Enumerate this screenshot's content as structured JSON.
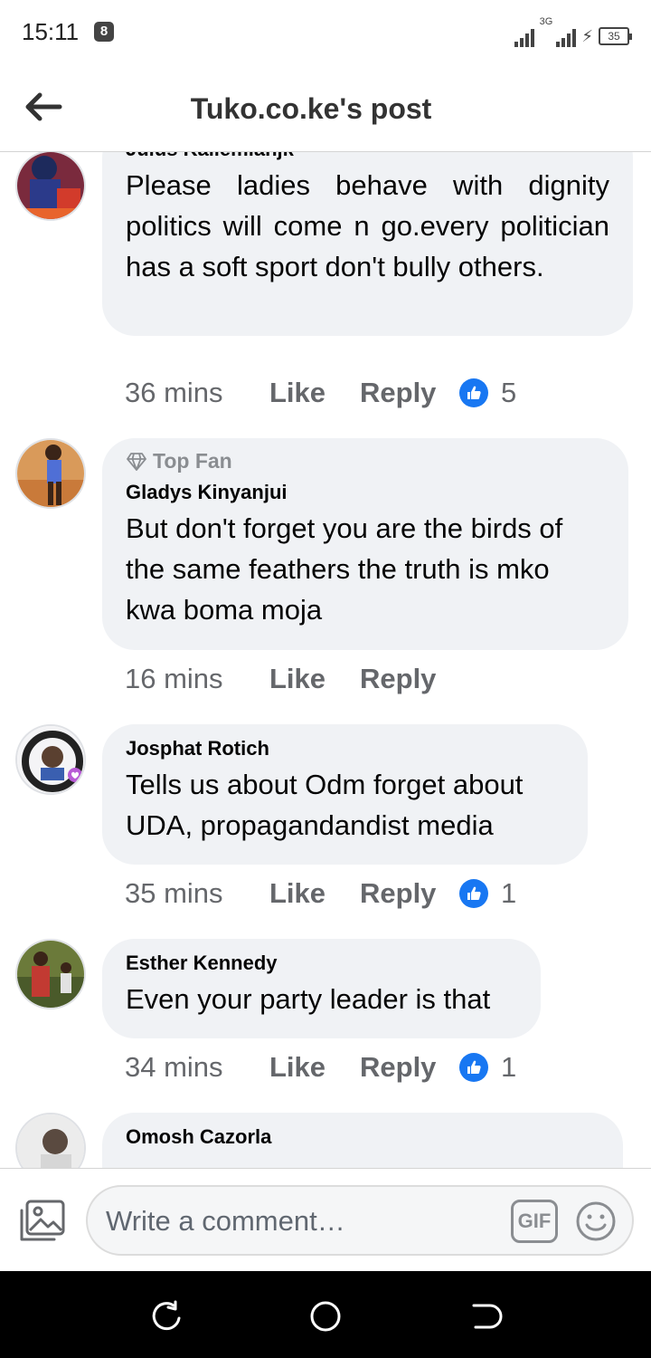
{
  "status_bar": {
    "time": "15:11",
    "notification_badge": "8",
    "network_label": "3G",
    "battery": "35"
  },
  "header": {
    "title": "Tuko.co.ke's post",
    "back_icon": "back-arrow-icon"
  },
  "comments": [
    {
      "author": "Julus Kailemiahjk",
      "badge": "",
      "text": "Please ladies behave with dignity politics will come n go.every politician has a soft sport don't bully others.",
      "time": "36 mins",
      "like_label": "Like",
      "reply_label": "Reply",
      "reactions": "5"
    },
    {
      "author": "Gladys Kinyanjui",
      "badge": "Top Fan",
      "text": "But don't forget you are the birds of the same feathers the truth is mko kwa boma moja",
      "time": "16 mins",
      "like_label": "Like",
      "reply_label": "Reply",
      "reactions": ""
    },
    {
      "author": "Josphat Rotich",
      "badge": "",
      "text": "Tells us about Odm forget about UDA, propagandandist media",
      "time": "35 mins",
      "like_label": "Like",
      "reply_label": "Reply",
      "reactions": "1"
    },
    {
      "author": "Esther Kennedy",
      "badge": "",
      "text": "Even your party leader is that",
      "time": "34 mins",
      "like_label": "Like",
      "reply_label": "Reply",
      "reactions": "1"
    },
    {
      "author": "Omosh Cazorla",
      "badge": "",
      "text": "",
      "time": "",
      "like_label": "",
      "reply_label": "",
      "reactions": ""
    }
  ],
  "comment_bar": {
    "placeholder": "Write a comment…",
    "gif_label": "GIF"
  },
  "colors": {
    "accent": "#1877f2",
    "bubble": "#f0f2f5",
    "meta_text": "#65676b"
  }
}
